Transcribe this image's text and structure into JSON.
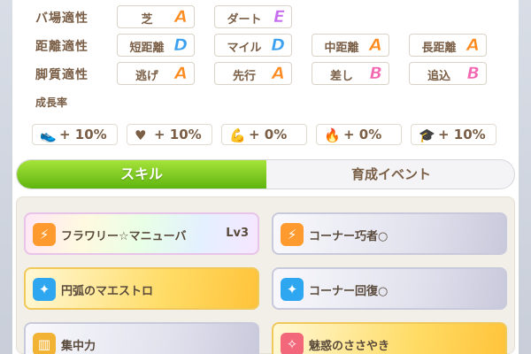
{
  "aptitude": {
    "rows": [
      {
        "label": "バ場適性",
        "cells": [
          {
            "name": "芝",
            "grade": "A",
            "color": "#ff8a1f"
          },
          {
            "name": "ダート",
            "grade": "E",
            "color": "#c66cf0"
          }
        ]
      },
      {
        "label": "距離適性",
        "cells": [
          {
            "name": "短距離",
            "grade": "D",
            "color": "#3aa0ef"
          },
          {
            "name": "マイル",
            "grade": "D",
            "color": "#3aa0ef"
          },
          {
            "name": "中距離",
            "grade": "A",
            "color": "#ff8a1f"
          },
          {
            "name": "長距離",
            "grade": "A",
            "color": "#ff8a1f"
          }
        ]
      },
      {
        "label": "脚質適性",
        "cells": [
          {
            "name": "逃げ",
            "grade": "A",
            "color": "#ff8a1f"
          },
          {
            "name": "先行",
            "grade": "A",
            "color": "#ff8a1f"
          },
          {
            "name": "差し",
            "grade": "B",
            "color": "#f267b0"
          },
          {
            "name": "追込",
            "grade": "B",
            "color": "#f267b0"
          }
        ]
      }
    ]
  },
  "growth": {
    "title": "成長率",
    "items": [
      {
        "icon": "speed-icon",
        "glyph": "👟",
        "value": "+ 10%"
      },
      {
        "icon": "stamina-heart-icon",
        "glyph": "♥",
        "value": "+ 10%"
      },
      {
        "icon": "power-arm-icon",
        "glyph": "💪",
        "value": "+ 0%"
      },
      {
        "icon": "guts-flame-icon",
        "glyph": "🔥",
        "value": "+ 0%"
      },
      {
        "icon": "wisdom-cap-icon",
        "glyph": "🎓",
        "value": "+ 10%"
      }
    ]
  },
  "tabs": {
    "skill": "スキル",
    "event": "育成イベント"
  },
  "skills": [
    {
      "name": "フラワリー☆マニューバ",
      "level": "Lv3",
      "style": "rainbow",
      "icon": "speed-up-icon",
      "icon_color": "#ff9a2e"
    },
    {
      "name": "コーナー巧者○",
      "level": "",
      "style": "normal",
      "icon": "speed-up-icon",
      "icon_color": "#ff9a2e"
    },
    {
      "name": "円弧のマエストロ",
      "level": "",
      "style": "gold",
      "icon": "recovery-sparkle-icon",
      "icon_color": "#2fa6f0"
    },
    {
      "name": "コーナー回復○",
      "level": "",
      "style": "normal",
      "icon": "recovery-sparkle-icon",
      "icon_color": "#2fa6f0"
    },
    {
      "name": "集中力",
      "level": "",
      "style": "normal",
      "icon": "gate-icon",
      "icon_color": "#f2b233"
    },
    {
      "name": "魅惑のささやき",
      "level": "",
      "style": "gold",
      "icon": "debuff-sparkle-icon",
      "icon_color": "#f2687a"
    }
  ]
}
